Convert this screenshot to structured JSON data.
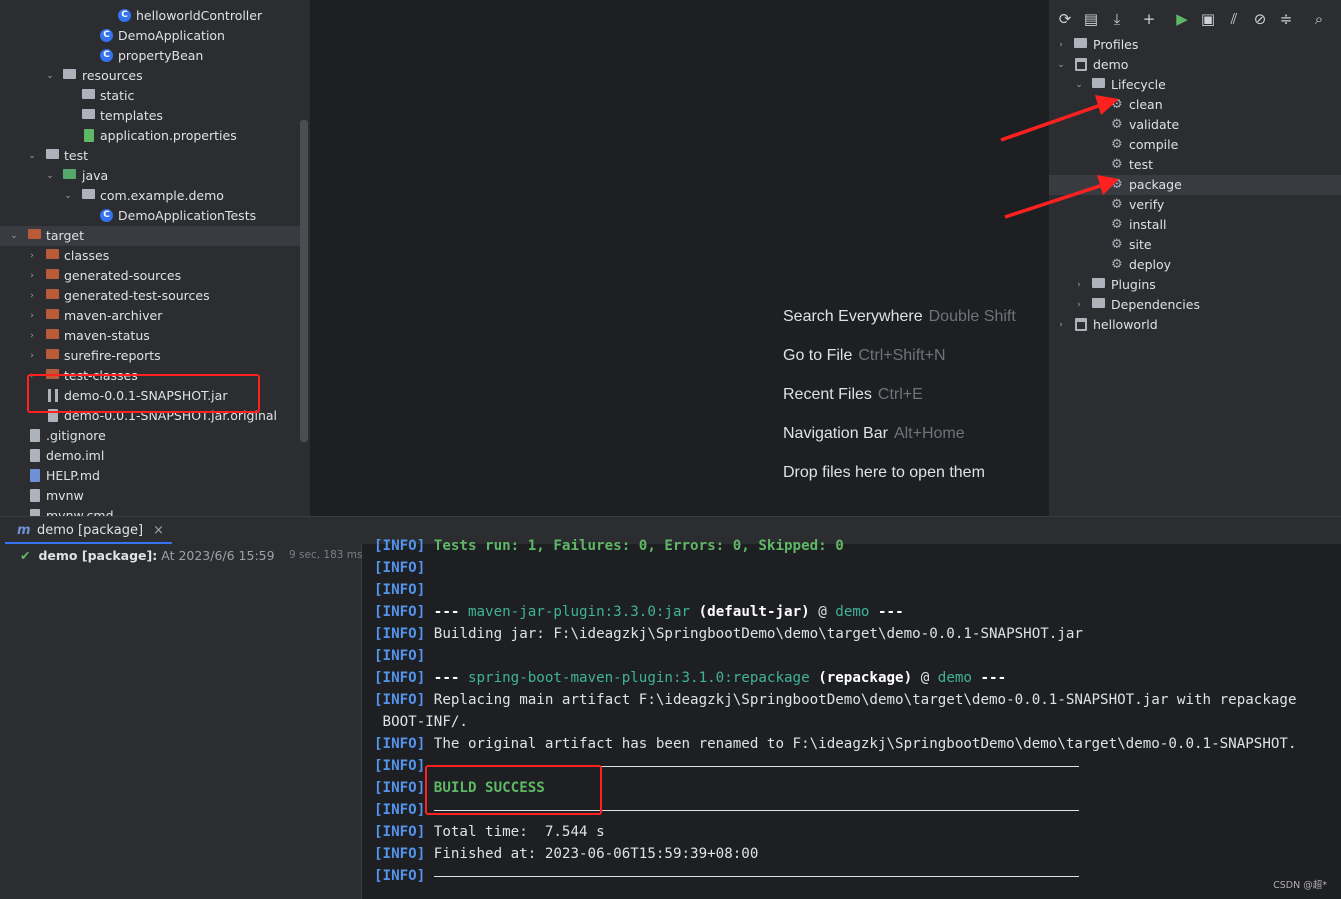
{
  "project_tree": {
    "rows": [
      {
        "label": "helloworldController"
      },
      {
        "label": "DemoApplication"
      },
      {
        "label": "propertyBean"
      },
      {
        "label": "resources"
      },
      {
        "label": "static"
      },
      {
        "label": "templates"
      },
      {
        "label": "application.properties"
      },
      {
        "label": "test"
      },
      {
        "label": "java"
      },
      {
        "label": "com.example.demo"
      },
      {
        "label": "DemoApplicationTests"
      },
      {
        "label": "target"
      },
      {
        "label": "classes"
      },
      {
        "label": "generated-sources"
      },
      {
        "label": "generated-test-sources"
      },
      {
        "label": "maven-archiver"
      },
      {
        "label": "maven-status"
      },
      {
        "label": "surefire-reports"
      },
      {
        "label": "test-classes"
      },
      {
        "label": "demo-0.0.1-SNAPSHOT.jar"
      },
      {
        "label": "demo-0.0.1-SNAPSHOT.jar.original"
      },
      {
        "label": ".gitignore"
      },
      {
        "label": "demo.iml"
      },
      {
        "label": "HELP.md"
      },
      {
        "label": "mvnw"
      },
      {
        "label": "mvnw.cmd"
      }
    ]
  },
  "welcome": {
    "search": {
      "label": "Search Everywhere",
      "key": "Double Shift"
    },
    "goto_file": {
      "label": "Go to File",
      "key": "Ctrl+Shift+N"
    },
    "recent": {
      "label": "Recent Files",
      "key": "Ctrl+E"
    },
    "navbar": {
      "label": "Navigation Bar",
      "key": "Alt+Home"
    },
    "drop": "Drop files here to open them"
  },
  "maven": {
    "toolbar_icons": [
      "reload-icon",
      "add-project-icon",
      "download-icon",
      "plus-icon",
      "run-icon",
      "execute-goal-icon",
      "toggle-offline-icon",
      "skip-tests-icon",
      "collapse-icon",
      "analyze-icon"
    ],
    "tree": {
      "profiles": "Profiles",
      "demo": "demo",
      "lifecycle": "Lifecycle",
      "goals": [
        "clean",
        "validate",
        "compile",
        "test",
        "package",
        "verify",
        "install",
        "site",
        "deploy"
      ],
      "selected_goal": "package",
      "plugins": "Plugins",
      "dependencies": "Dependencies",
      "helloworld": "helloworld"
    }
  },
  "run": {
    "tab_label": "demo [package]",
    "tab_close": "×",
    "item": {
      "name": "demo [package]:",
      "time": "At 2023/6/6 15:59",
      "duration": "9 sec, 183 ms"
    },
    "tag": "[INFO]",
    "lines": {
      "tests": "Tests run: 1, Failures: 0, Errors: 0, Skipped: 0",
      "jar_pre": "--- ",
      "jar_plugin": "maven-jar-plugin:3.3.0:jar",
      "jar_goal": "(default-jar)",
      "jar_at": " @ ",
      "jar_proj": "demo",
      "jar_post": " ---",
      "building": "Building jar: F:\\ideagzkj\\SpringbootDemo\\demo\\target\\demo-0.0.1-SNAPSHOT.jar",
      "sb_pre": "--- ",
      "sb_plugin": "spring-boot-maven-plugin:3.1.0:repackage",
      "sb_goal": "(repackage)",
      "sb_at": " @ ",
      "sb_proj": "demo",
      "sb_post": " ---",
      "replacing": "Replacing main artifact F:\\ideagzkj\\SpringbootDemo\\demo\\target\\demo-0.0.1-SNAPSHOT.jar with repackage",
      "boot_inf": " BOOT-INF/.",
      "original": "The original artifact has been renamed to F:\\ideagzkj\\SpringbootDemo\\demo\\target\\demo-0.0.1-SNAPSHOT.",
      "success": "BUILD SUCCESS",
      "total": "Total time:  7.544 s",
      "finished": "Finished at: 2023-06-06T15:59:39+08:00"
    }
  },
  "watermark": "CSDN @超*",
  "colors": {
    "annotation": "#ff2020",
    "info": "#5394ec",
    "success": "#5fb865",
    "plugin": "#3fb39a"
  }
}
